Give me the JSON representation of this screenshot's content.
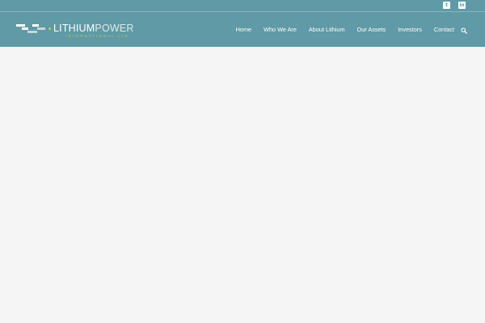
{
  "header": {
    "background_color": "#5f9aa6",
    "logo": {
      "text_main_bold": "LITHIUM",
      "text_main_light": "POWER",
      "text_sub": "INTERNATIONAL LTD",
      "accent_color": "#a9d157"
    },
    "nav": {
      "items": [
        {
          "label": "Home"
        },
        {
          "label": "Who We Are"
        },
        {
          "label": "About Lithium"
        },
        {
          "label": "Our Assets"
        },
        {
          "label": "Investors"
        },
        {
          "label": "Contact"
        }
      ]
    },
    "search": {
      "icon": "search-icon"
    }
  },
  "topbar": {
    "social": [
      {
        "icon": "twitter-icon",
        "glyph": "t"
      },
      {
        "icon": "linkedin-icon",
        "glyph": "in"
      }
    ]
  },
  "content": {
    "background_color": "#f5f5f5"
  }
}
